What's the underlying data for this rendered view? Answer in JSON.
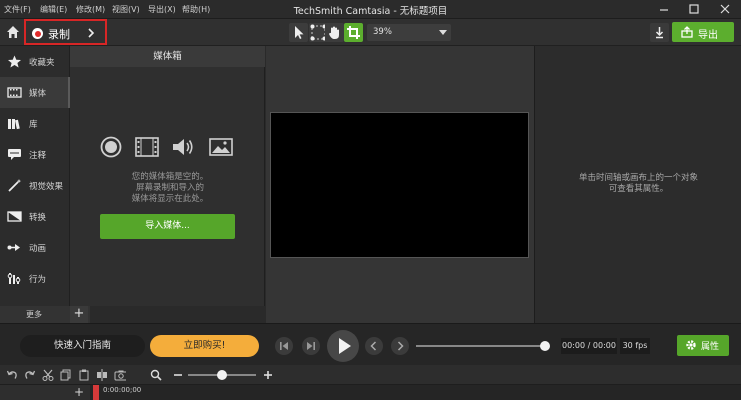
{
  "window": {
    "title": "TechSmith Camtasia - 无标题项目",
    "menu": [
      "文件(F)",
      "编辑(E)",
      "修改(M)",
      "视图(V)",
      "导出(X)",
      "帮助(H)"
    ]
  },
  "toolbar": {
    "record_label": "录制",
    "zoom_value": "39%",
    "export_label": "导出"
  },
  "sidebar": {
    "items": [
      {
        "label": "收藏夹",
        "icon": "star-icon"
      },
      {
        "label": "媒体",
        "icon": "film-icon"
      },
      {
        "label": "库",
        "icon": "library-icon"
      },
      {
        "label": "注释",
        "icon": "annotation-icon"
      },
      {
        "label": "视觉效果",
        "icon": "magic-wand-icon"
      },
      {
        "label": "转换",
        "icon": "transition-icon"
      },
      {
        "label": "动画",
        "icon": "animation-icon"
      },
      {
        "label": "行为",
        "icon": "behavior-icon"
      }
    ],
    "more_label": "更多",
    "add_label": "+"
  },
  "media_bin": {
    "header": "媒体箱",
    "empty_line1": "您的媒体箱是空的。",
    "empty_line2": "屏幕录制和导入的",
    "empty_line3": "媒体将显示在此处。",
    "import_label": "导入媒体..."
  },
  "properties": {
    "hint_line1": "单击时间轴或画布上的一个对象",
    "hint_line2": "可查看其属性。"
  },
  "playback": {
    "quick_start_label": "快速入门指南",
    "buy_now_label": "立即购买!",
    "time": "00:00 / 00:00",
    "fps": "30 fps",
    "properties_label": "属性",
    "scrub_fraction": 1.0
  },
  "timeline": {
    "ruler_time": "0:00:00;00",
    "add_track_label": "+"
  },
  "colors": {
    "accent_green": "#5cae2e",
    "record_red": "#d72626",
    "buy_orange": "#f4ad3b"
  }
}
